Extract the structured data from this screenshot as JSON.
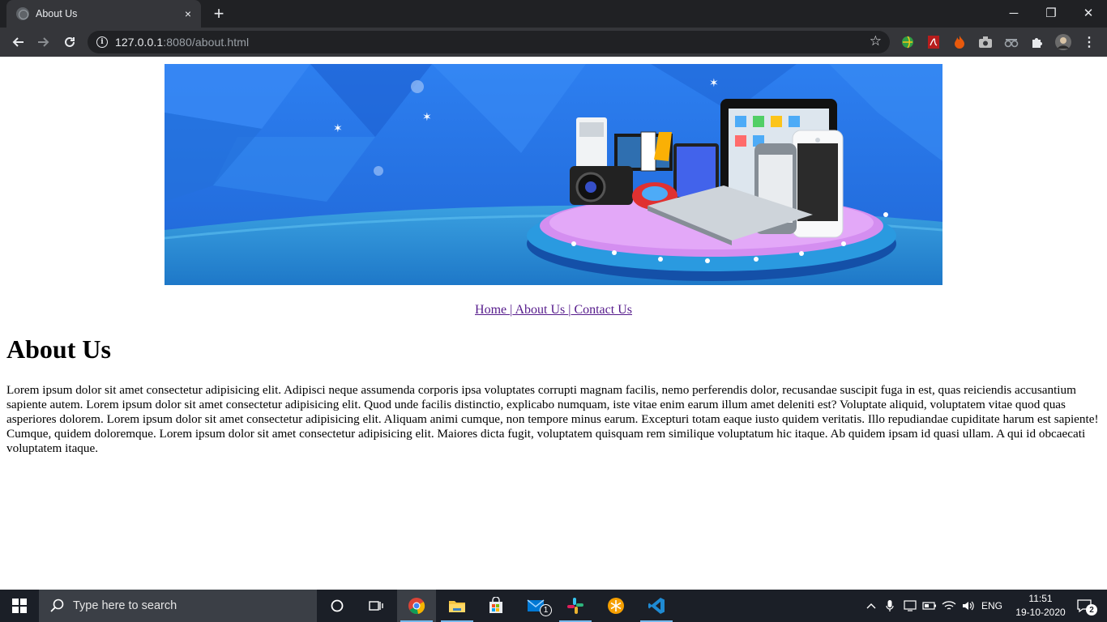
{
  "browser": {
    "tab_title": "About Us",
    "tab_close_icon": "×",
    "new_tab_icon": "+",
    "url_host": "127.0.0.1",
    "url_rest": ":8080/about.html"
  },
  "window_controls": {
    "minimize": "─",
    "restore": "❐",
    "close": "✕"
  },
  "page": {
    "nav": {
      "home": "Home ",
      "sep1": "|",
      "about": " About Us ",
      "sep2": "|",
      "contact": " Contact Us"
    },
    "heading": "About Us",
    "paragraph": "Lorem ipsum dolor sit amet consectetur adipisicing elit. Adipisci neque assumenda corporis ipsa voluptates corrupti magnam facilis, nemo perferendis dolor, recusandae suscipit fuga in est, quas reiciendis accusantium sapiente autem. Lorem ipsum dolor sit amet consectetur adipisicing elit. Quod unde facilis distinctio, explicabo numquam, iste vitae enim earum illum amet deleniti est? Voluptate aliquid, voluptatem vitae quod quas asperiores dolorem. Lorem ipsum dolor sit amet consectetur adipisicing elit. Aliquam animi cumque, non tempore minus earum. Excepturi totam eaque iusto quidem veritatis. Illo repudiandae cupiditate harum est sapiente! Cumque, quidem doloremque. Lorem ipsum dolor sit amet consectetur adipisicing elit. Maiores dicta fugit, voluptatem quisquam rem similique voluptatum hic itaque. Ab quidem ipsam id quasi ullam. A qui id obcaecati voluptatem itaque."
  },
  "taskbar": {
    "search_placeholder": "Type here to search",
    "mail_badge": "1",
    "language": "ENG",
    "time": "11:51",
    "date": "19-10-2020",
    "notification_count": "2"
  },
  "colors": {
    "titlebar": "#202124",
    "toolbar": "#35363a",
    "link_visited": "#551a8b",
    "banner_blue": "#2a7be8",
    "taskbar": "#1b1f27"
  }
}
